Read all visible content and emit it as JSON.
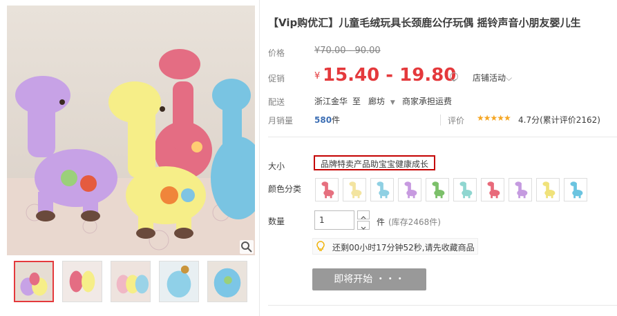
{
  "product": {
    "title": "【Vip购优汇】儿童毛绒玩具长颈鹿公仔玩偶 摇铃声音小朋友婴儿生"
  },
  "price": {
    "label": "价格",
    "currency": "¥",
    "original": "70.00 - 90.00"
  },
  "promo": {
    "label": "促销",
    "currency": "¥",
    "value": "15.40 - 19.80",
    "store_activity": "店铺活动"
  },
  "delivery": {
    "label": "配送",
    "from": "浙江金华",
    "to_word": "至",
    "to": "廊坊",
    "fee": "商家承担运费"
  },
  "sales": {
    "label": "月销量",
    "count": "580",
    "unit": "件",
    "rating_label": "评价",
    "stars": "★★★★★",
    "rating": "4.7分(累计评价2162)"
  },
  "size": {
    "label": "大小",
    "option": "品牌特卖产品助宝宝健康成长"
  },
  "color": {
    "label": "颜色分类",
    "swatches": [
      "#e6707f",
      "#f3e4a0",
      "#8fd0e3",
      "#c79ae0",
      "#7cc06a",
      "#8fd6d0",
      "#e86a7a",
      "#c59be0",
      "#f0e27a",
      "#6bc4e0"
    ]
  },
  "quantity": {
    "label": "数量",
    "value": "1",
    "unit": "件",
    "stock": "(库存2468件)"
  },
  "countdown": {
    "text": "还剩00小时17分钟52秒,请先收藏商品"
  },
  "button": {
    "label": "即将开始 ・・・"
  },
  "colors": {
    "accent": "#e4393c",
    "button": "#999999",
    "stars": "#f5a623"
  }
}
